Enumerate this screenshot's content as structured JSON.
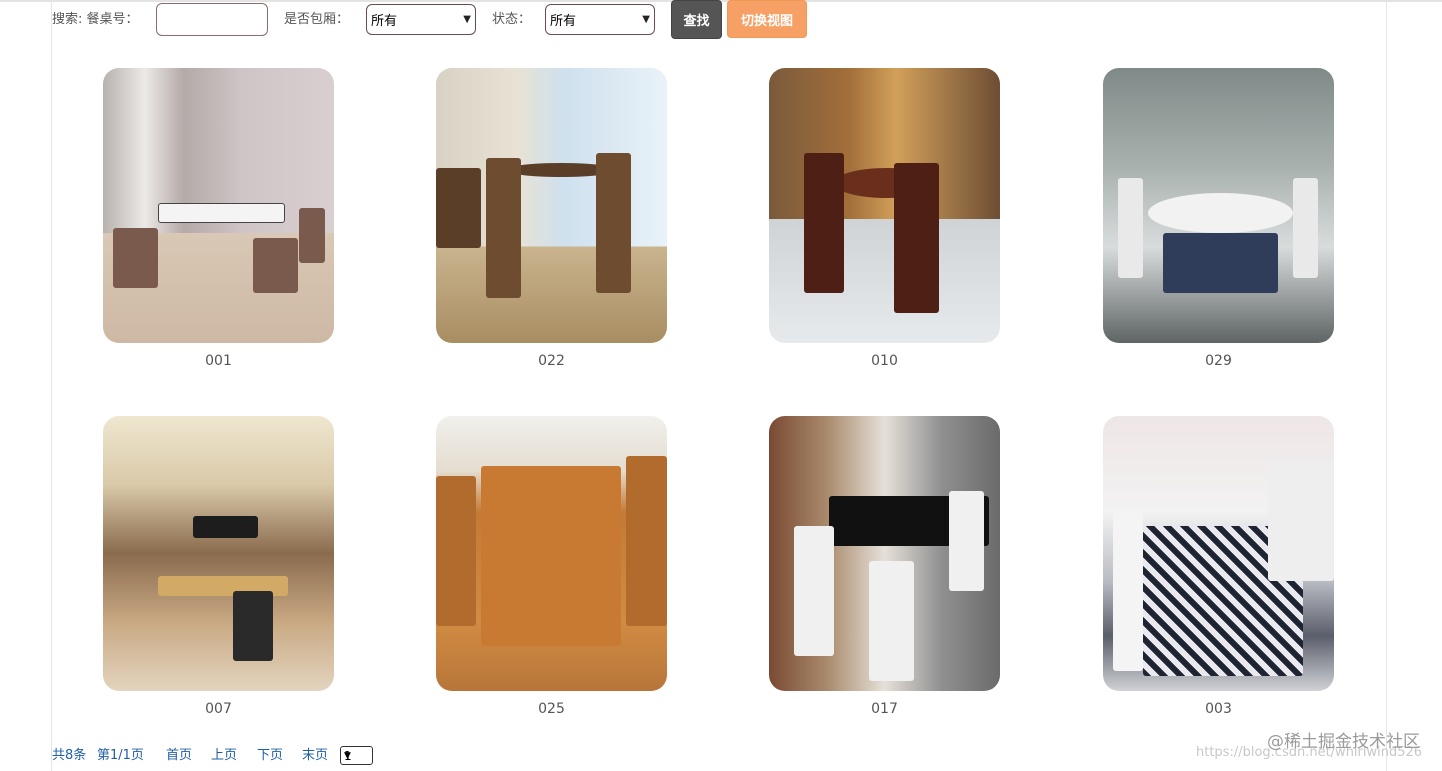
{
  "toolbar": {
    "search_label": "搜索: 餐桌号：",
    "search_value": "",
    "private_room_label": "是否包厢：",
    "private_room_selected": "所有",
    "status_label": "状态：",
    "status_selected": "所有",
    "search_button": "查找",
    "switch_view_button": "切换视图"
  },
  "tables": [
    {
      "number": "001"
    },
    {
      "number": "022"
    },
    {
      "number": "010"
    },
    {
      "number": "029"
    },
    {
      "number": "007"
    },
    {
      "number": "025"
    },
    {
      "number": "017"
    },
    {
      "number": "003"
    }
  ],
  "pager": {
    "total": "共8条",
    "page_info": "第1/1页",
    "first": "首页",
    "prev": "上页",
    "next": "下页",
    "last": "末页",
    "page_selected": "1"
  },
  "watermark": {
    "text": "@稀土掘金技术社区",
    "url": "https://blog.csdn.net/whirlwind526"
  },
  "colors": {
    "search_button": "#555555",
    "switch_button": "#f6a065",
    "link": "#1f5fa8"
  }
}
